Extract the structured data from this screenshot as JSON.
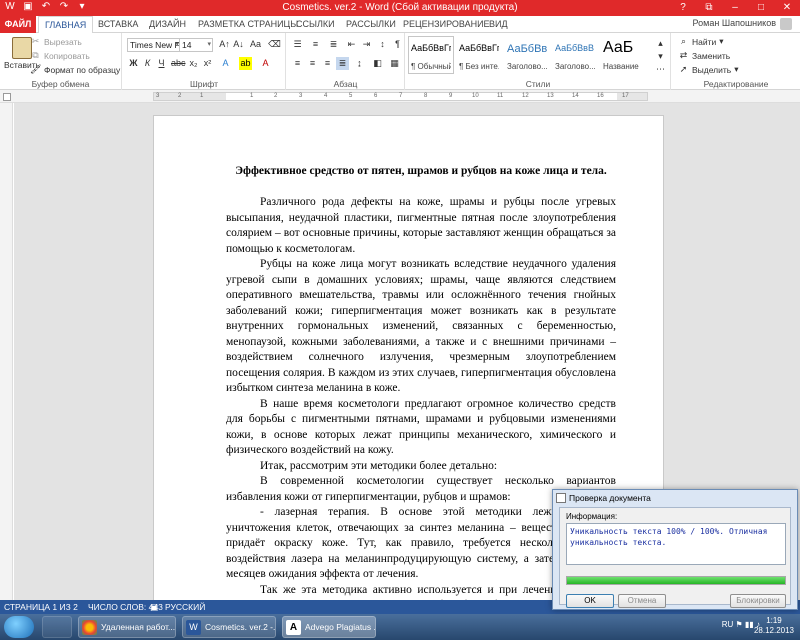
{
  "window": {
    "title": "Cosmetics. ver.2 - Word (Сбой активации продукта)",
    "accent": "#e0292a"
  },
  "tabs": {
    "file": "ФАЙЛ",
    "items": [
      "ГЛАВНАЯ",
      "ВСТАВКА",
      "ДИЗАЙН",
      "РАЗМЕТКА СТРАНИЦЫ",
      "ССЫЛКИ",
      "РАССЫЛКИ",
      "РЕЦЕНЗИРОВАНИЕ",
      "ВИД"
    ],
    "active": "ГЛАВНАЯ",
    "user": "Роман Шапошников"
  },
  "ribbon": {
    "clipboard": {
      "paste": "Вставить",
      "cut": "Вырезать",
      "copy": "Копировать",
      "format_painter": "Формат по образцу",
      "label": "Буфер обмена"
    },
    "font": {
      "name": "Times New F",
      "size": "14",
      "label": "Шрифт"
    },
    "paragraph": {
      "label": "Абзац"
    },
    "styles": {
      "label": "Стили",
      "items": [
        {
          "sample": "АаБбВвГг,",
          "name": "¶ Обычный"
        },
        {
          "sample": "АаБбВвГг,",
          "name": "¶ Без инте..."
        },
        {
          "sample": "АаБбВв",
          "name": "Заголово..."
        },
        {
          "sample": "АаБбВвВ",
          "name": "Заголово..."
        },
        {
          "sample": "АаБ",
          "name": "Название"
        }
      ]
    },
    "editing": {
      "find": "Найти",
      "replace": "Заменить",
      "select": "Выделить",
      "label": "Редактирование"
    }
  },
  "document": {
    "heading": "Эффективное средство от пятен, шрамов и рубцов на коже лица и тела.",
    "paragraphs": [
      "Различного рода дефекты на коже, шрамы и рубцы после угревых высыпания, неудачной пластики, пигментные пятная после злоупотребления солярием – вот основные причины, которые заставляют женщин обращаться за помощью к косметологам.",
      "Рубцы на коже лица могут возникать вследствие неудачного удаления угревой сыпи в домашних условиях; шрамы, чаще являются следствием оперативного вмешательства, травмы или осложнённого течения гнойных заболеваний кожи; гиперпигментация может возникать как в результате внутренних гормональных изменений, связанных с беременностью, менопаузой, кожными заболеваниями, а также и с внешними причинами – воздействием солнечного излучения, чрезмерным злоупотреблением посещения солярия. В каждом из этих случаев, гиперпигментация обусловлена избытком синтеза меланина в коже.",
      "В наше время косметологи предлагают огромное количество средств для борьбы с пигментными пятнами, шрамами и рубцовыми изменениями кожи, в основе которых лежат принципы механического, химического и физического воздействий на кожу.",
      "Итак, рассмотрим эти методики более детально:",
      "В современной косметологии существует несколько вариантов избавления кожи от гиперпигментации, рубцов и шрамов:",
      "- лазерная терапия. В основе этой методики лежит принцип уничтожения клеток, отвечающих за синтез меланина – вещества, который придаёт окраску коже. Тут, как правило, требуется несколько сеансов воздействия лазера на меланинпродуцирующую систему, а затем несколько месяцев ожидания эффекта от лечения.",
      "Так же эта методика активно используется и при лечении рубцовых изменений кожи. Только впоследствии, требует более бережного ухода."
    ]
  },
  "status": {
    "page": "СТРАНИЦА 1 ИЗ 2",
    "words": "ЧИСЛО СЛОВ: 443",
    "language": "РУССКИЙ"
  },
  "dialog": {
    "title": "Проверка документа",
    "info_label": "Информация:",
    "info_text": "Уникальность текста 100% / 100%. Отличная уникальность текста.",
    "progress": 1.0,
    "ok": "OK",
    "cancel": "Отмена",
    "block": "Блокировки"
  },
  "taskbar": {
    "tasks": [
      {
        "label": "Удаленная работ..."
      },
      {
        "label": "Cosmetics. ver.2 -..."
      },
      {
        "label": "Advego Plagiatus ..."
      }
    ],
    "tray_lang": "RU",
    "time": "1:19",
    "date": "28.12.2013"
  }
}
